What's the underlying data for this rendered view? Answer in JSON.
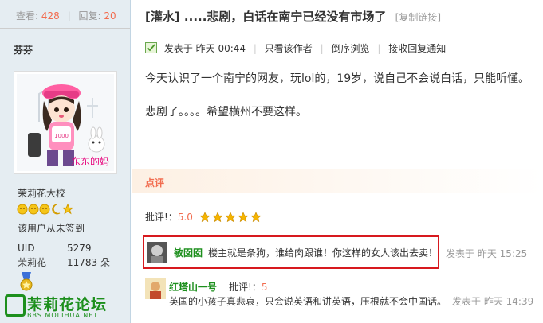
{
  "sidebar": {
    "views_label": "查看:",
    "views_count": "428",
    "replies_label": "回复:",
    "replies_count": "20",
    "username": "芬芬",
    "avatar_caption": "东东的妈",
    "rank_title": "茉莉花大校",
    "checkin_status": "该用户从未签到",
    "uid_label": "UID",
    "uid_value": "5279",
    "points_label": "茉莉花",
    "points_value": "11783 朵"
  },
  "logo": {
    "text": "茉莉花论坛",
    "url": "BBS.MOLIHUA.NET"
  },
  "thread": {
    "title": "[灌水] .....悲剧，白话在南宁已经没有市场了",
    "copy_link": "[复制链接]"
  },
  "postinfo": {
    "posted": "发表于  昨天 00:44",
    "only_author": "只看该作者",
    "reverse": "倒序浏览",
    "notify": "接收回复通知"
  },
  "content": {
    "para1": "今天认识了一个南宁的网友，玩lol的，19岁，说自己不会说白话，只能听懂。",
    "para2": "悲剧了。。。。希望横州不要这样。"
  },
  "rating": {
    "header": "点评",
    "score_label": "批评!：",
    "score_value": "5.0",
    "stars": 5
  },
  "comments": [
    {
      "name": "敏囡囡",
      "text": "楼主就是条狗，谁给肉跟谁！你这样的女人该出去卖！",
      "time": "发表于  昨天 15:25"
    },
    {
      "name": "红塔山一号",
      "rate_label": "批评!：",
      "rate_value": "5",
      "text": "英国的小孩子真悲哀，只会说英语和讲英语，压根就不会中国话。",
      "time": "发表于  昨天 14:39"
    }
  ],
  "colors": {
    "accent": "#f26c4f",
    "sidebar_bg": "#e5edf2",
    "highlight_border": "#d7191e",
    "name_green": "#1d8f1d"
  }
}
